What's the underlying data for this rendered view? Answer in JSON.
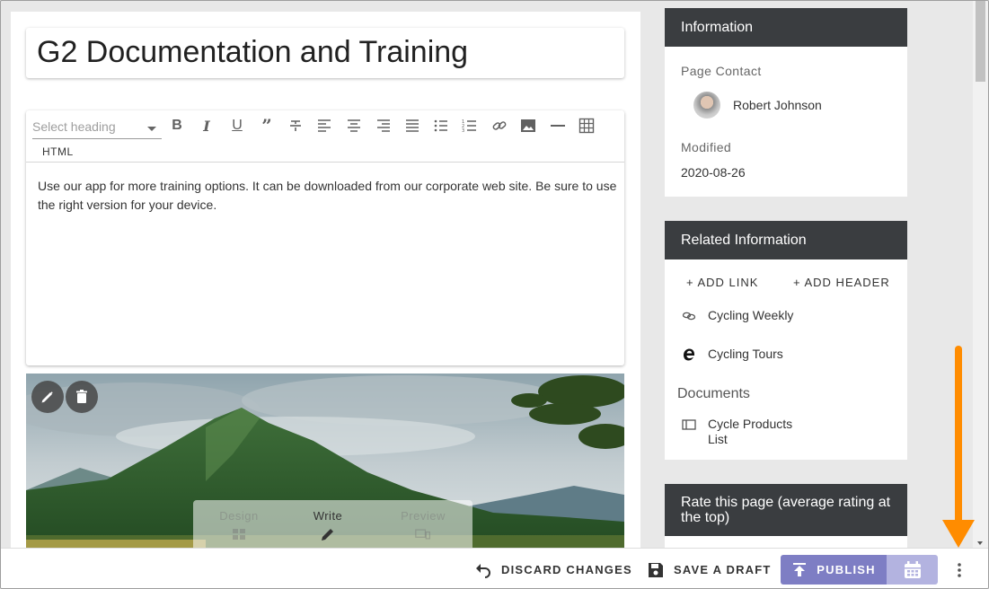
{
  "page": {
    "title": "G2 Documentation and Training"
  },
  "editor": {
    "heading_placeholder": "Select heading",
    "html_label": "HTML",
    "toolbar_icons": [
      "bold-icon",
      "italic-icon",
      "underline-icon",
      "quote-icon",
      "strikethrough-icon",
      "align-left-icon",
      "align-center-icon",
      "align-right-icon",
      "align-justify-icon",
      "bulleted-list-icon",
      "numbered-list-icon",
      "link-icon",
      "image-icon",
      "horizontal-rule-icon",
      "table-icon"
    ],
    "body_text": "Use our app for more training options. It can be downloaded from our corporate web site. Be sure to use the right version for your device."
  },
  "image_block": {
    "modes": {
      "design": "Design",
      "write": "Write",
      "preview": "Preview"
    },
    "active_mode": "Write"
  },
  "information": {
    "header": "Information",
    "contact_label": "Page Contact",
    "contact_name": "Robert Johnson",
    "modified_label": "Modified",
    "modified_value": "2020-08-26"
  },
  "related": {
    "header": "Related Information",
    "add_link": "ADD LINK",
    "add_header": "ADD HEADER",
    "items": [
      {
        "label": "Cycling Weekly",
        "icon": "link-icon"
      },
      {
        "label": "Cycling Tours",
        "icon": "edge-browser-icon"
      }
    ],
    "documents_title": "Documents",
    "documents": [
      {
        "label_line1": "Cycle Products",
        "label_line2": "List",
        "icon": "document-icon"
      }
    ]
  },
  "rate": {
    "header": "Rate this page (average rating at the top)"
  },
  "footer": {
    "discard": "DISCARD CHANGES",
    "save_draft": "SAVE A DRAFT",
    "publish": "PUBLISH"
  },
  "colors": {
    "header_bg": "#3a3d40",
    "publish_bg": "#7e7ec4",
    "schedule_bg": "#b3b3e0",
    "annotation_arrow": "#ff8c00"
  }
}
